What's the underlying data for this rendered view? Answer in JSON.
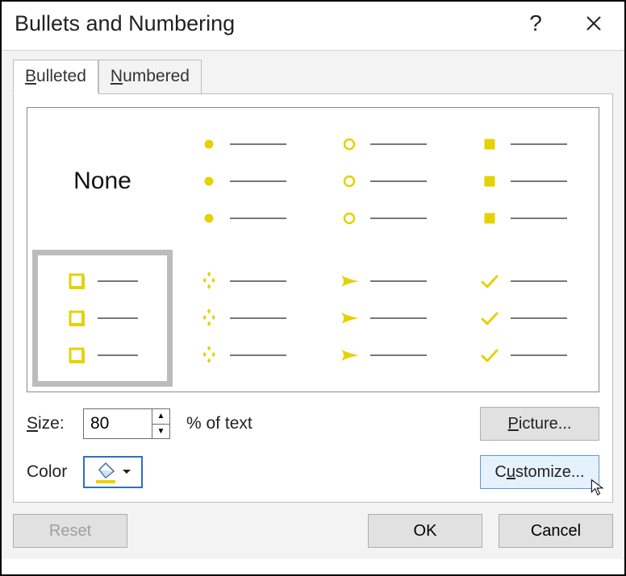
{
  "dialog": {
    "title": "Bullets and Numbering"
  },
  "tabs": {
    "bulleted": "Bulleted",
    "numbered": "Numbered",
    "active": "Bulleted"
  },
  "bullet_styles": [
    {
      "id": "none",
      "label": "None"
    },
    {
      "id": "disc",
      "marker": "filled-circle"
    },
    {
      "id": "ring",
      "marker": "open-circle"
    },
    {
      "id": "square",
      "marker": "filled-square"
    },
    {
      "id": "open-square",
      "marker": "open-square",
      "selected": true
    },
    {
      "id": "four-diamonds",
      "marker": "four-diamonds"
    },
    {
      "id": "arrowhead",
      "marker": "arrowhead"
    },
    {
      "id": "check",
      "marker": "check"
    }
  ],
  "size": {
    "label": "Size:",
    "value": "80",
    "suffix": "% of text"
  },
  "color": {
    "label": "Color",
    "swatch": "#e5d200"
  },
  "buttons": {
    "picture": "Picture...",
    "customize": "Customize...",
    "reset": "Reset",
    "ok": "OK",
    "cancel": "Cancel"
  }
}
